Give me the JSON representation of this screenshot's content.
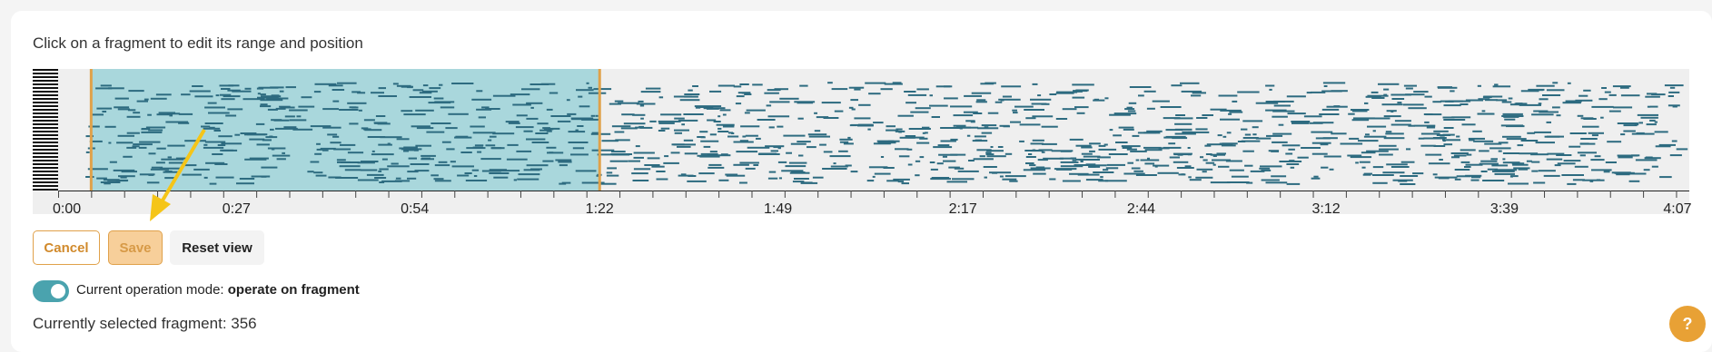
{
  "instruction": "Click on a fragment to edit its range and position",
  "timeline": {
    "tick_labels": [
      "0:00",
      "0:27",
      "0:54",
      "1:22",
      "1:49",
      "2:17",
      "2:44",
      "3:12",
      "3:39",
      "4:07"
    ],
    "duration_seconds": 247,
    "tick_step_seconds": 5,
    "selected_fragment_range": {
      "start": "0:05",
      "end": "1:22"
    }
  },
  "buttons": {
    "cancel": "Cancel",
    "save": "Save",
    "reset_view": "Reset view",
    "help": "?"
  },
  "mode": {
    "label": "Current operation mode:",
    "value": "operate on fragment",
    "enabled": true
  },
  "selection": {
    "text": "Currently selected fragment: 356"
  },
  "colors": {
    "accent": "#e0a14a",
    "selection_fill": "#a9d7dc",
    "note": "#2d6b80",
    "toggle": "#4aa3ae",
    "arrow": "#f5c518"
  }
}
